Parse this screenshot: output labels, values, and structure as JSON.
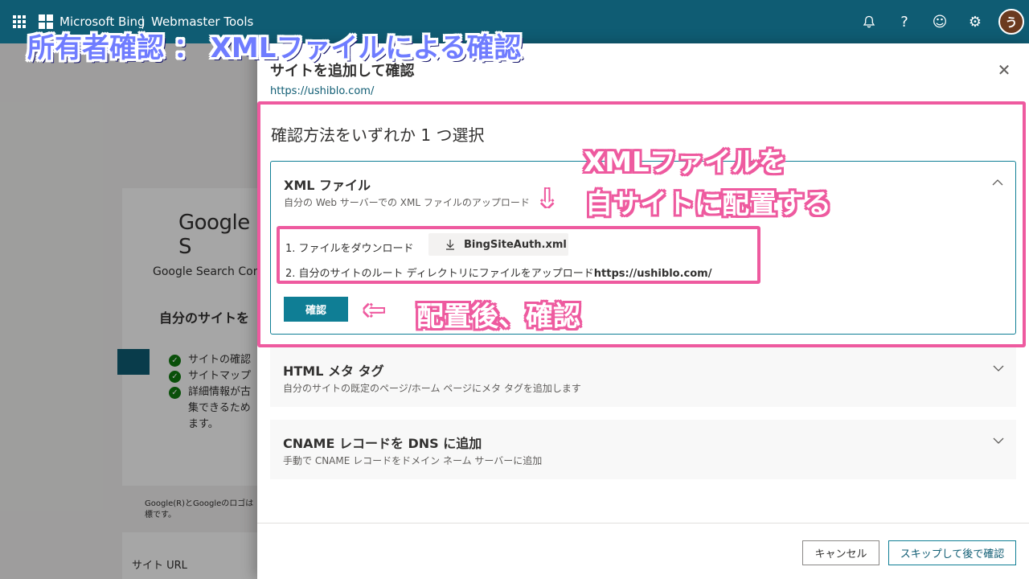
{
  "topbar": {
    "brand": "Microsoft Bing",
    "product": "Webmaster Tools",
    "avatar_initial": "う",
    "icons": [
      "bell-icon",
      "help-icon",
      "feedback-smiley-icon",
      "gear-icon"
    ]
  },
  "background": {
    "google_logo": "Google S",
    "google_search_console": "Google Search Con",
    "heading": "自分のサイトを",
    "benefits": [
      "サイトの確認",
      "サイトマップ",
      "詳細情報が古",
      "集できるため",
      "ます。"
    ],
    "note_line1": "Google(R)とGoogleのロゴは",
    "note_line2": "標です。",
    "site_url_label": "サイト URL"
  },
  "panel": {
    "title": "サイトを追加して確認",
    "url": "https://ushiblo.com/",
    "choose_method": "確認方法をいずれか 1 つ選択",
    "methods": [
      {
        "title": "XML ファイル",
        "description": "自分の Web サーバーでの XML ファイルのアップロード",
        "expanded": true,
        "step1_label": "1. ファイルをダウンロード",
        "download_file": "BingSiteAuth.xml",
        "step2_label": "2. 自分のサイトのルート ディレクトリにファイルをアップロード",
        "step2_url": "https://ushiblo.com/",
        "verify_button": "確認"
      },
      {
        "title": "HTML メタ タグ",
        "description": "自分のサイトの既定のページ/ホーム ページにメタ タグを追加します",
        "expanded": false
      },
      {
        "title": "CNAME レコードを DNS に追加",
        "description": "手動で CNAME レコードをドメイン ネーム サーバーに追加",
        "expanded": false
      }
    ],
    "cancel_button": "キャンセル",
    "skip_button": "スキップして後で確認"
  },
  "annotations": {
    "main_caption": "所有者確認 ： XMLファイルによる確認",
    "xml_caption_line1": "XMLファイルを",
    "xml_caption_line2": "自サイトに配置する",
    "after_caption": "配置後、確認",
    "arrow_down": "↓",
    "arrow_left": "←",
    "highlight_color": "#ee5a9f",
    "caption_color": "#6f7cff"
  },
  "colors": {
    "topbar": "#0f5c73",
    "accent": "#0f7e95"
  }
}
